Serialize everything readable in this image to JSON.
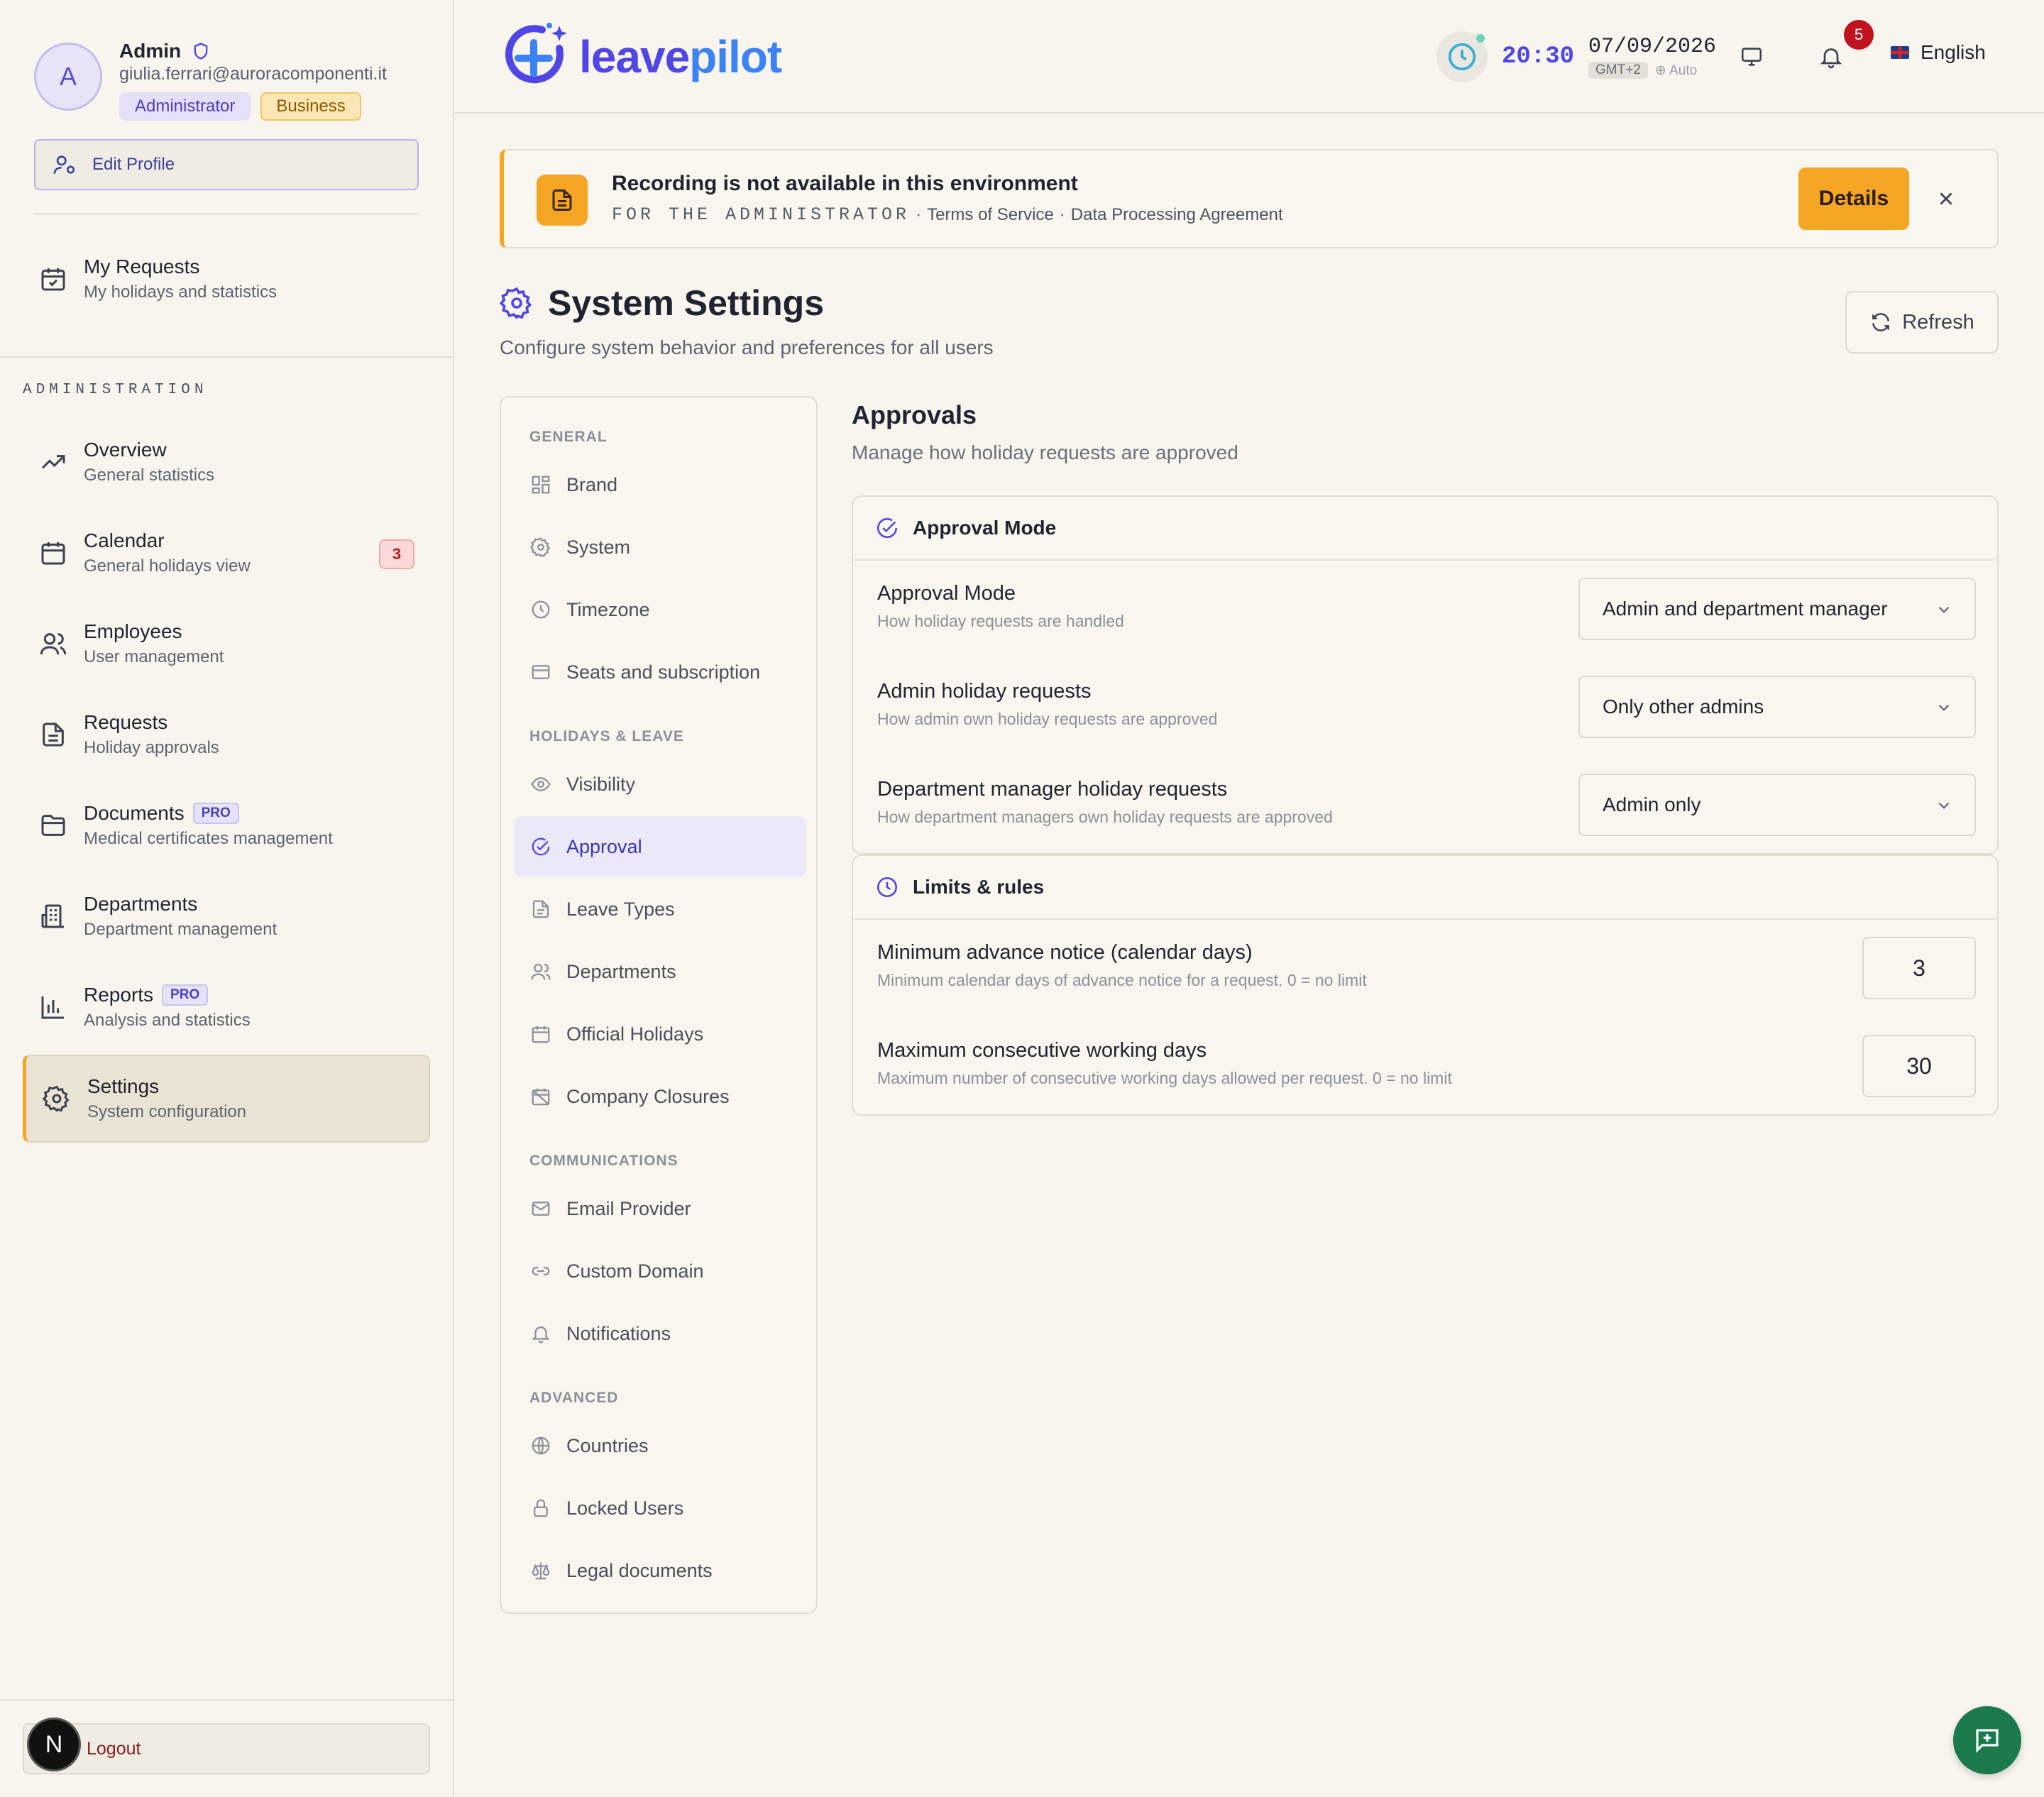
{
  "profile": {
    "initial": "A",
    "name": "Admin",
    "email": "giulia.ferrari@auroracomponenti.it",
    "role_badge": "Administrator",
    "plan_badge": "Business",
    "edit_label": "Edit Profile"
  },
  "sidebar": {
    "my_requests": {
      "title": "My Requests",
      "subtitle": "My holidays and statistics",
      "icon": "calendar-check-icon"
    },
    "section_label": "ADMINISTRATION",
    "items": [
      {
        "title": "Overview",
        "subtitle": "General statistics",
        "icon": "trending-up-icon"
      },
      {
        "title": "Calendar",
        "subtitle": "General holidays view",
        "icon": "calendar-icon",
        "badge": "3"
      },
      {
        "title": "Employees",
        "subtitle": "User management",
        "icon": "users-icon"
      },
      {
        "title": "Requests",
        "subtitle": "Holiday approvals",
        "icon": "file-text-icon"
      },
      {
        "title": "Documents",
        "subtitle": "Medical certificates management",
        "icon": "folder-icon",
        "pro": "PRO"
      },
      {
        "title": "Departments",
        "subtitle": "Department management",
        "icon": "building-icon"
      },
      {
        "title": "Reports",
        "subtitle": "Analysis and statistics",
        "icon": "bar-chart-icon",
        "pro": "PRO"
      },
      {
        "title": "Settings",
        "subtitle": "System configuration",
        "icon": "gear-icon",
        "active": true
      }
    ],
    "logout_label": "Logout",
    "user_initial": "N"
  },
  "topbar": {
    "logo_part1": "leave",
    "logo_part2": "pilot",
    "time": "20:30",
    "date": "07/09/2026",
    "timezone": "GMT+2",
    "tz_mode": "⊕ Auto",
    "notifications_count": "5",
    "language": "English"
  },
  "banner": {
    "title": "Recording is not available in this environment",
    "audience": "FOR THE ADMINISTRATOR",
    "link1": "Terms of Service",
    "link2": "Data Processing Agreement",
    "details_label": "Details"
  },
  "header": {
    "title": "System Settings",
    "subtitle": "Configure system behavior and preferences for all users",
    "refresh_label": "Refresh"
  },
  "settings_nav": {
    "general_label": "GENERAL",
    "general": [
      {
        "label": "Brand",
        "icon": "grid-icon"
      },
      {
        "label": "System",
        "icon": "gear-icon"
      },
      {
        "label": "Timezone",
        "icon": "clock-icon"
      },
      {
        "label": "Seats and subscription",
        "icon": "credit-card-icon"
      }
    ],
    "holidays_label": "HOLIDAYS & LEAVE",
    "holidays": [
      {
        "label": "Visibility",
        "icon": "eye-icon"
      },
      {
        "label": "Approval",
        "icon": "check-circle-icon",
        "active": true
      },
      {
        "label": "Leave Types",
        "icon": "file-icon"
      },
      {
        "label": "Departments",
        "icon": "users-icon"
      },
      {
        "label": "Official Holidays",
        "icon": "calendar-icon"
      },
      {
        "label": "Company Closures",
        "icon": "calendar-off-icon"
      }
    ],
    "comms_label": "COMMUNICATIONS",
    "comms": [
      {
        "label": "Email Provider",
        "icon": "mail-icon"
      },
      {
        "label": "Custom Domain",
        "icon": "link-icon"
      },
      {
        "label": "Notifications",
        "icon": "bell-icon"
      }
    ],
    "advanced_label": "ADVANCED",
    "advanced": [
      {
        "label": "Countries",
        "icon": "globe-icon"
      },
      {
        "label": "Locked Users",
        "icon": "lock-icon"
      },
      {
        "label": "Legal documents",
        "icon": "scale-icon"
      }
    ]
  },
  "approvals": {
    "title": "Approvals",
    "subtitle": "Manage how holiday requests are approved",
    "mode_card": {
      "title": "Approval Mode",
      "rows": [
        {
          "label": "Approval Mode",
          "help": "How holiday requests are handled",
          "value": "Admin and department manager"
        },
        {
          "label": "Admin holiday requests",
          "help": "How admin own holiday requests are approved",
          "value": "Only other admins"
        },
        {
          "label": "Department manager holiday requests",
          "help": "How department managers own holiday requests are approved",
          "value": "Admin only"
        }
      ]
    },
    "limits_card": {
      "title": "Limits & rules",
      "rows": [
        {
          "label": "Minimum advance notice (calendar days)",
          "help": "Minimum calendar days of advance notice for a request. 0 = no limit",
          "value": "3"
        },
        {
          "label": "Maximum consecutive working days",
          "help": "Maximum number of consecutive working days allowed per request. 0 = no limit",
          "value": "30"
        }
      ]
    }
  },
  "colors": {
    "accent": "#4f46e5",
    "warning": "#f5a524",
    "background": "#f7f5ee",
    "danger": "#c1121f",
    "fab": "#1a7a4a"
  }
}
